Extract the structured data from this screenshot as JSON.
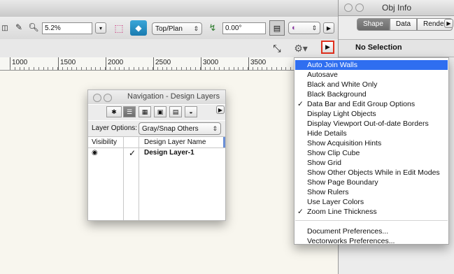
{
  "toolbar": {
    "zoom_value": "5.2%",
    "view_select": "Top/Plan",
    "rotation_value": "0.00°"
  },
  "ruler": {
    "labels": [
      "1000",
      "1500",
      "2000",
      "2500",
      "3000",
      "3500"
    ]
  },
  "obj_info": {
    "title": "Obj Info",
    "tabs": [
      "Shape",
      "Data",
      "Render"
    ],
    "selection_status": "No Selection"
  },
  "navigation": {
    "title": "Navigation - Design Layers",
    "layer_options_label": "Layer Options:",
    "layer_options_value": "Gray/Snap Others",
    "columns": [
      "Visibility",
      "Design Layer Name"
    ],
    "rows": [
      {
        "name": "Design Layer-1",
        "checked": "✓"
      }
    ]
  },
  "menu": {
    "items": [
      {
        "label": "Auto Join Walls",
        "check": "",
        "highlighted": true
      },
      {
        "label": "Autosave",
        "check": ""
      },
      {
        "label": "Black and White Only",
        "check": ""
      },
      {
        "label": "Black Background",
        "check": ""
      },
      {
        "label": "Data Bar and Edit Group Options",
        "check": "✓"
      },
      {
        "label": "Display Light Objects",
        "check": ""
      },
      {
        "label": "Display Viewport Out-of-date Borders",
        "check": ""
      },
      {
        "label": "Hide Details",
        "check": ""
      },
      {
        "label": "Show Acquisition Hints",
        "check": ""
      },
      {
        "label": "Show Clip Cube",
        "check": ""
      },
      {
        "label": "Show Grid",
        "check": ""
      },
      {
        "label": "Show Other Objects While in Edit Modes",
        "check": ""
      },
      {
        "label": "Show Page Boundary",
        "check": ""
      },
      {
        "label": "Show Rulers",
        "check": ""
      },
      {
        "label": "Use Layer Colors",
        "check": ""
      },
      {
        "label": "Zoom Line Thickness",
        "check": "✓"
      },
      {
        "label": "Document Preferences...",
        "check": ""
      },
      {
        "label": "Vectorworks Preferences...",
        "check": ""
      }
    ]
  },
  "colors": {
    "menu_highlight": "#2f6ef0",
    "highlight_box": "#e0301e",
    "canvas": "#f8f6ee"
  }
}
